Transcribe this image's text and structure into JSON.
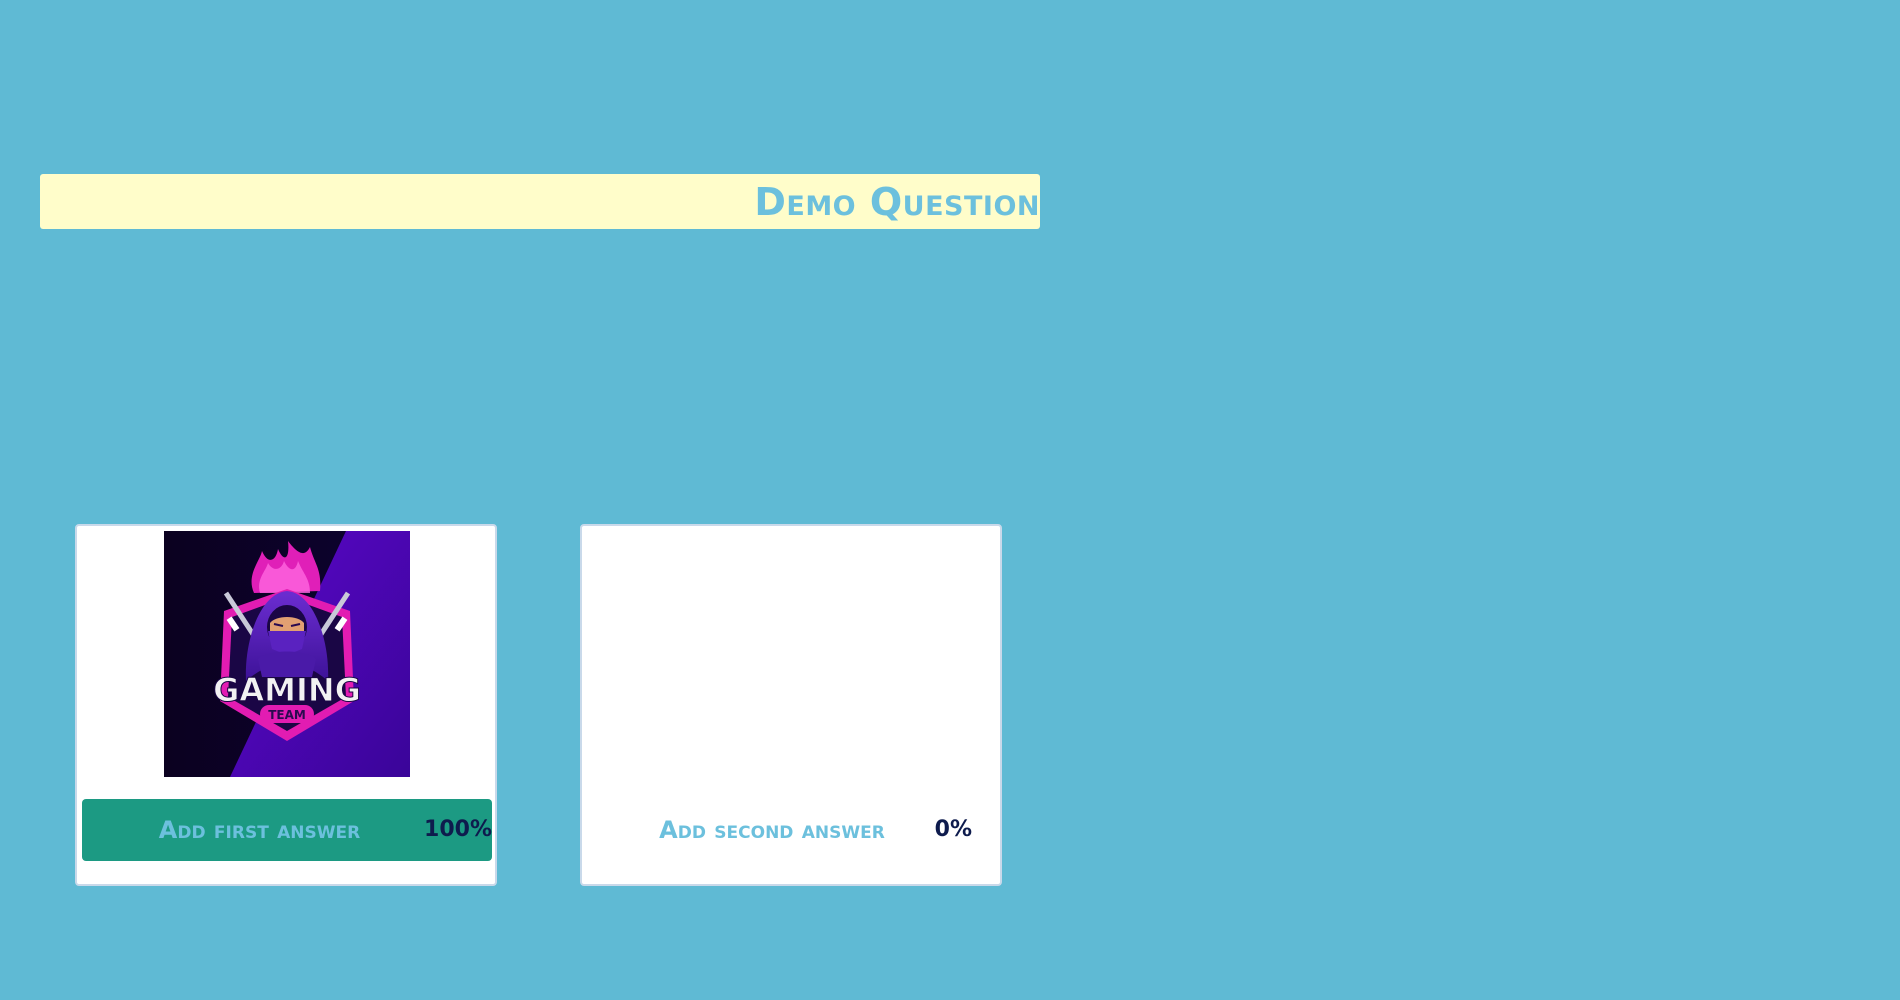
{
  "question": {
    "title": "Demo Question"
  },
  "answers": [
    {
      "label": "Add first answer",
      "percent": "100%",
      "percent_value": 100,
      "selected": true,
      "image": {
        "description_icon": "gaming-team-logo",
        "text_main": "GAMING",
        "text_sub": "TEAM"
      }
    },
    {
      "label": "Add second answer",
      "percent": "0%",
      "percent_value": 0,
      "selected": false
    }
  ],
  "colors": {
    "background": "#5fbad4",
    "question_bar": "#fffdca",
    "accent_text": "#6cc0dd",
    "selected_button": "#1c9a83",
    "percent_text": "#0e1b4d"
  }
}
